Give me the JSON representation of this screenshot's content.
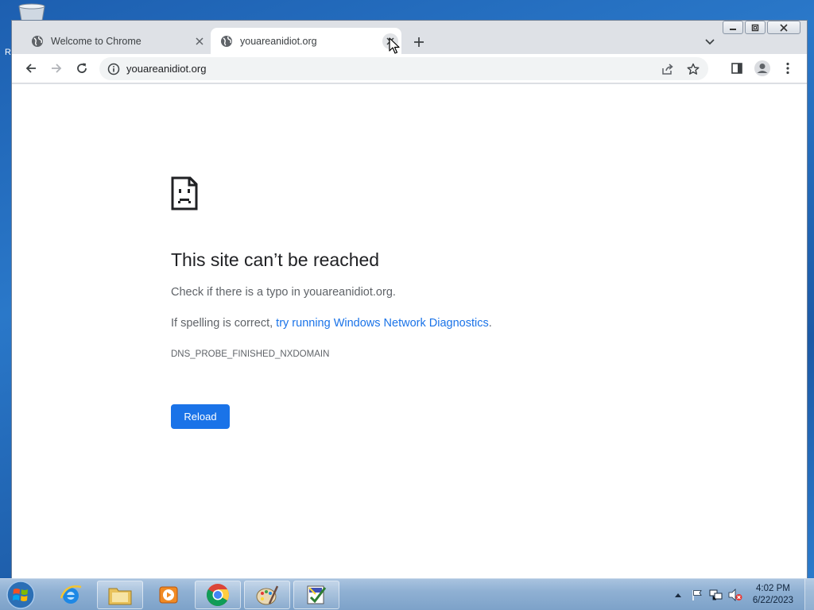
{
  "desktop": {
    "partial_icon_letter": "R"
  },
  "window": {
    "minimize": "minimize",
    "maximize": "maximize",
    "close": "close"
  },
  "tabs": [
    {
      "title": "Welcome to Chrome",
      "active": false
    },
    {
      "title": "youareanidiot.org",
      "active": true
    }
  ],
  "toolbar": {
    "url": "youareanidiot.org"
  },
  "error_page": {
    "title": "This site can’t be reached",
    "line1": "Check if there is a typo in youareanidiot.org.",
    "line2_prefix": "If spelling is correct, ",
    "line2_link": "try running Windows Network Diagnostics",
    "line2_suffix": ".",
    "code": "DNS_PROBE_FINISHED_NXDOMAIN",
    "reload_label": "Reload"
  },
  "taskbar": {
    "apps": [
      "internet-explorer-icon",
      "file-explorer-icon",
      "media-player-icon",
      "chrome-icon",
      "paint-icon",
      "task-app-icon"
    ],
    "clock_time": "4:02 PM",
    "clock_date": "6/22/2023"
  },
  "colors": {
    "link": "#1a73e8",
    "button": "#1a73e8",
    "title": "#202124",
    "body_text": "#5f6368"
  }
}
